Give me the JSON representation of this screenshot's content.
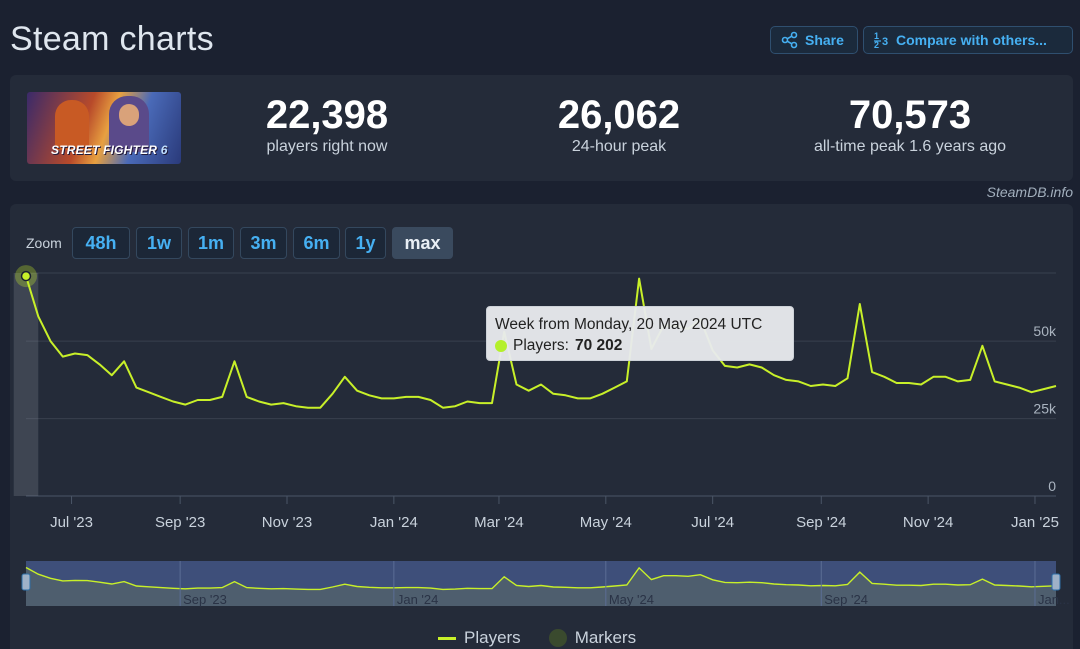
{
  "header": {
    "title": "Steam charts",
    "share_label": "Share",
    "compare_label": "Compare with others..."
  },
  "game": {
    "cover_logo": "STREET FIGHTER",
    "cover_logo_suffix": "6"
  },
  "stats": [
    {
      "value": "22,398",
      "label": "players right now"
    },
    {
      "value": "26,062",
      "label": "24-hour peak"
    },
    {
      "value": "70,573",
      "label": "all-time peak 1.6 years ago"
    }
  ],
  "credit": "SteamDB.info",
  "zoom": {
    "label": "Zoom",
    "options": [
      "48h",
      "1w",
      "1m",
      "3m",
      "6m",
      "1y",
      "max"
    ],
    "selected": "max"
  },
  "tooltip": {
    "header": "Week from Monday, 20 May 2024 UTC",
    "series_label": "Players:",
    "value": "70 202"
  },
  "legend": {
    "players": "Players",
    "markers": "Markers"
  },
  "colors": {
    "line": "#c8f029",
    "accent": "#46b0f2",
    "background": "#1b2130",
    "panel": "#242b39"
  },
  "chart_data": {
    "type": "line",
    "series": [
      {
        "name": "Players"
      }
    ],
    "x_tick_labels": [
      "Jul '23",
      "Sep '23",
      "Nov '23",
      "Jan '24",
      "Mar '24",
      "May '24",
      "Jul '24",
      "Sep '24",
      "Nov '24",
      "Jan '25"
    ],
    "y_tick_labels": [
      "0",
      "25k",
      "50k"
    ],
    "ylim": [
      0,
      72000
    ],
    "navigator_labels": [
      "Sep '23",
      "Jan '24",
      "May '24",
      "Sep '24",
      "Jan..."
    ],
    "x": [
      "2023-06-05",
      "2023-06-12",
      "2023-06-19",
      "2023-06-26",
      "2023-07-03",
      "2023-07-10",
      "2023-07-17",
      "2023-07-24",
      "2023-07-31",
      "2023-08-07",
      "2023-08-14",
      "2023-08-21",
      "2023-08-28",
      "2023-09-04",
      "2023-09-11",
      "2023-09-18",
      "2023-09-25",
      "2023-10-02",
      "2023-10-09",
      "2023-10-16",
      "2023-10-23",
      "2023-10-30",
      "2023-11-06",
      "2023-11-13",
      "2023-11-20",
      "2023-11-27",
      "2023-12-04",
      "2023-12-11",
      "2023-12-18",
      "2023-12-25",
      "2024-01-01",
      "2024-01-08",
      "2024-01-15",
      "2024-01-22",
      "2024-01-29",
      "2024-02-05",
      "2024-02-12",
      "2024-02-19",
      "2024-02-26",
      "2024-03-04",
      "2024-03-11",
      "2024-03-18",
      "2024-03-25",
      "2024-04-01",
      "2024-04-08",
      "2024-04-15",
      "2024-04-22",
      "2024-04-29",
      "2024-05-06",
      "2024-05-13",
      "2024-05-20",
      "2024-05-27",
      "2024-06-03",
      "2024-06-10",
      "2024-06-17",
      "2024-06-24",
      "2024-07-01",
      "2024-07-08",
      "2024-07-15",
      "2024-07-22",
      "2024-07-29",
      "2024-08-05",
      "2024-08-12",
      "2024-08-19",
      "2024-08-26",
      "2024-09-02",
      "2024-09-09",
      "2024-09-16",
      "2024-09-23",
      "2024-09-30",
      "2024-10-07",
      "2024-10-14",
      "2024-10-21",
      "2024-10-28",
      "2024-11-04",
      "2024-11-11",
      "2024-11-18",
      "2024-11-25",
      "2024-12-02",
      "2024-12-09",
      "2024-12-16",
      "2024-12-23",
      "2024-12-30",
      "2025-01-06",
      "2025-01-13"
    ],
    "values": [
      71000,
      58000,
      50000,
      45000,
      46000,
      45500,
      42500,
      39000,
      43500,
      35000,
      33500,
      32000,
      30500,
      29500,
      31000,
      31000,
      32000,
      43500,
      32000,
      30500,
      29500,
      30000,
      29000,
      28500,
      28500,
      33000,
      38500,
      34000,
      32500,
      31500,
      31500,
      32000,
      32000,
      31000,
      28500,
      29000,
      30500,
      30000,
      30000,
      53000,
      36000,
      34000,
      36000,
      33000,
      32500,
      31500,
      31500,
      33000,
      35000,
      37000,
      70202,
      47500,
      55000,
      55000,
      54000,
      57000,
      47000,
      42000,
      41500,
      42500,
      41500,
      39000,
      37500,
      37000,
      35500,
      36000,
      35500,
      38000,
      62000,
      40000,
      38500,
      36500,
      36500,
      36000,
      38500,
      38500,
      37000,
      37500,
      48500,
      37000,
      36000,
      35000,
      33500,
      34500,
      35500
    ]
  }
}
